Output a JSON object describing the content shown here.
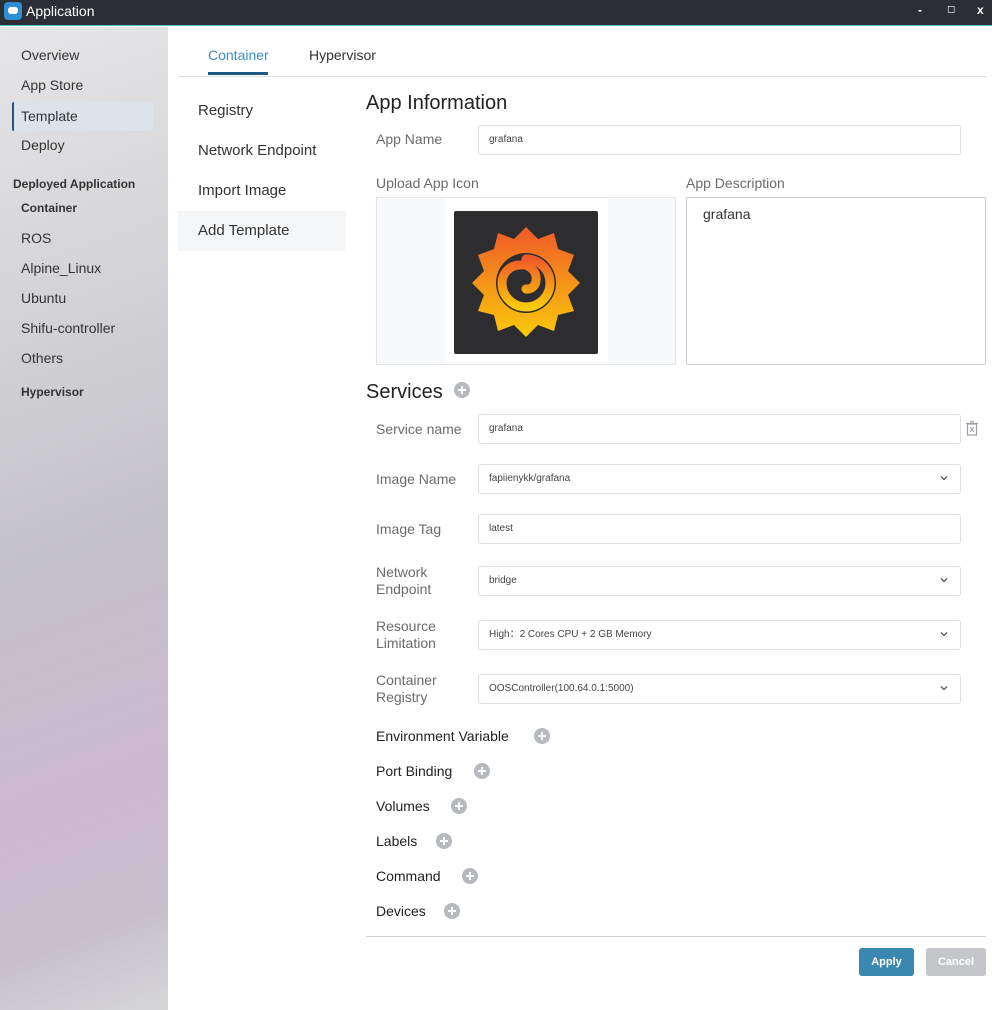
{
  "window": {
    "title": "Application",
    "minimize": "-",
    "maximize": "◻",
    "close": "x"
  },
  "sidebar": {
    "items": [
      {
        "label": "Overview"
      },
      {
        "label": "App Store"
      },
      {
        "label": "Template"
      },
      {
        "label": "Deploy"
      }
    ],
    "deployed_section": "Deployed Application",
    "container_section": "Container",
    "deployed_items": [
      {
        "label": "ROS"
      },
      {
        "label": "Alpine_Linux"
      },
      {
        "label": "Ubuntu"
      },
      {
        "label": "Shifu-controller"
      },
      {
        "label": "Others"
      }
    ],
    "hypervisor_section": "Hypervisor"
  },
  "tabs": [
    {
      "label": "Container"
    },
    {
      "label": "Hypervisor"
    }
  ],
  "submenu": [
    {
      "label": "Registry"
    },
    {
      "label": "Network Endpoint"
    },
    {
      "label": "Import Image"
    },
    {
      "label": "Add Template"
    }
  ],
  "app_info": {
    "title": "App Information",
    "app_name_label": "App Name",
    "app_name_value": "grafana",
    "upload_icon_label": "Upload App Icon",
    "description_label": "App Description",
    "description_value": "grafana"
  },
  "services": {
    "title": "Services",
    "service_name_label": "Service name",
    "service_name_value": "grafana",
    "image_name_label": "Image Name",
    "image_name_value": "fapiienykk/grafana",
    "image_tag_label": "Image Tag",
    "image_tag_value": "latest",
    "network_endpoint_label_1": "Network",
    "network_endpoint_label_2": "Endpoint",
    "network_endpoint_value": "bridge",
    "resource_label_1": "Resource",
    "resource_label_2": "Limitation",
    "resource_value": "High：2 Cores CPU + 2 GB Memory",
    "registry_label_1": "Container",
    "registry_label_2": "Registry",
    "registry_value": "OOSController(100.64.0.1:5000)"
  },
  "extra_sections": [
    {
      "label": "Environment Variable"
    },
    {
      "label": "Port Binding"
    },
    {
      "label": "Volumes"
    },
    {
      "label": "Labels"
    },
    {
      "label": "Command"
    },
    {
      "label": "Devices"
    }
  ],
  "actions": {
    "apply": "Apply",
    "cancel": "Cancel"
  },
  "colors": {
    "accent": "#3b8ec6",
    "apply_button": "#3a87b0",
    "cancel_button": "#c4c6c9",
    "titlebar": "#2b2f35"
  }
}
